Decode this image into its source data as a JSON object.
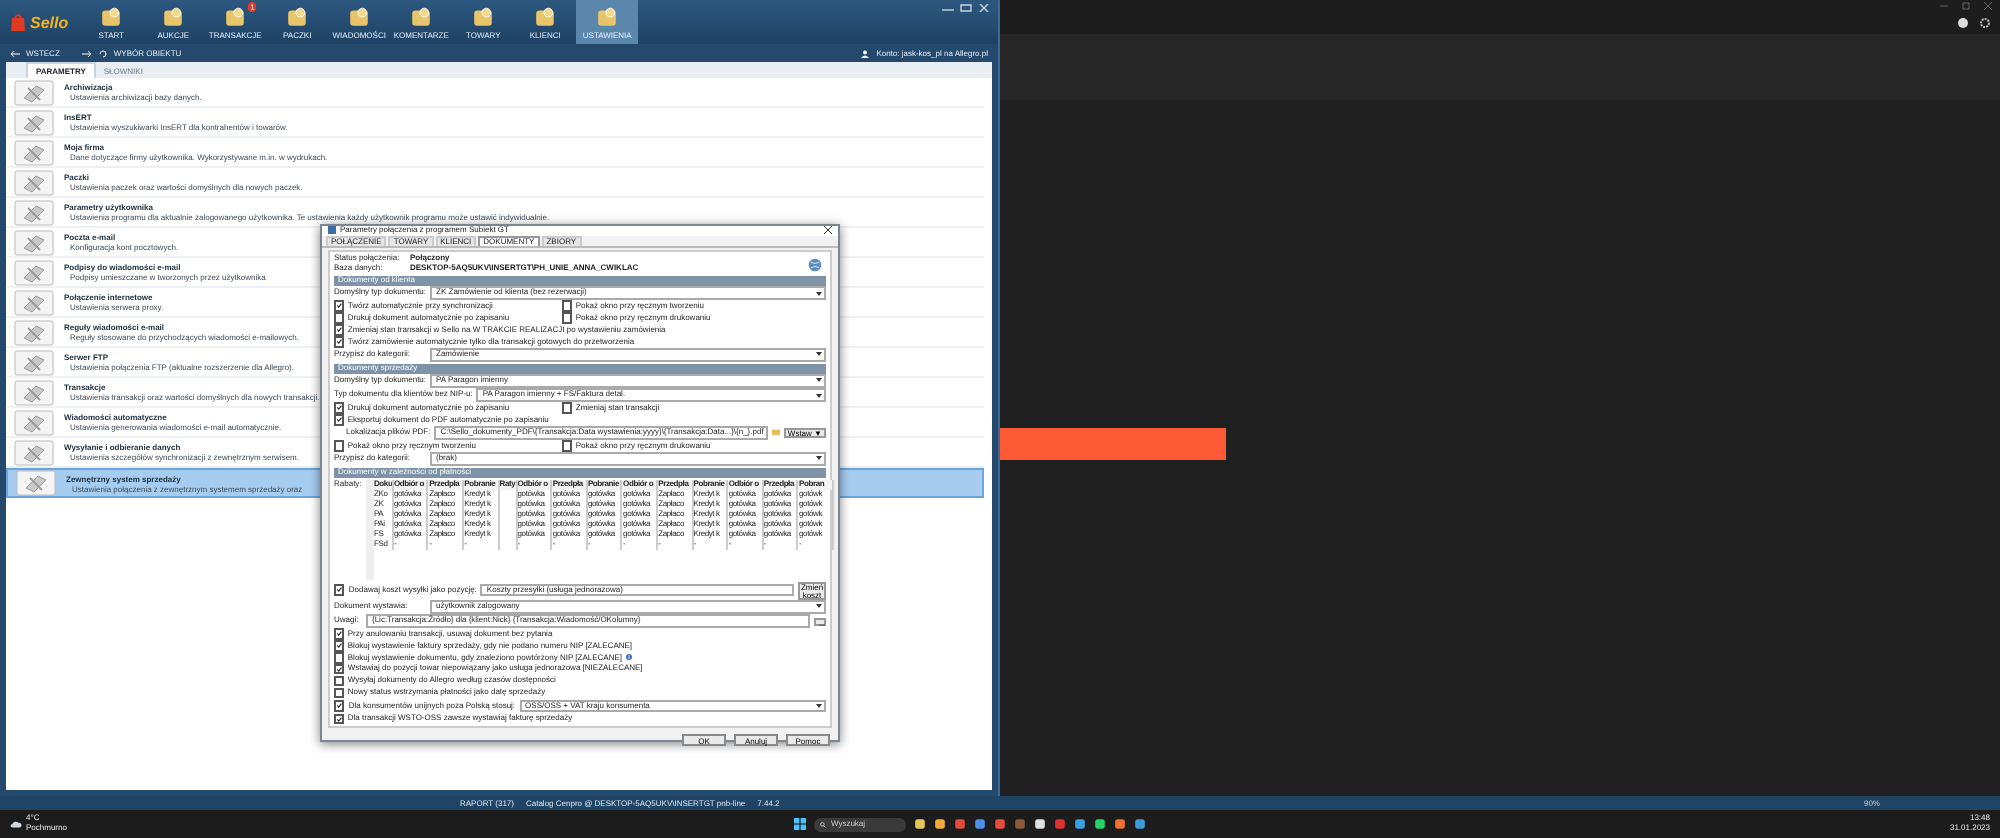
{
  "toolbar": {
    "logo": "Sello",
    "items": [
      {
        "label": "START",
        "selected": false
      },
      {
        "label": "AUKCJE",
        "selected": false
      },
      {
        "label": "TRANSAKCJE",
        "selected": false,
        "badge": "1"
      },
      {
        "label": "PACZKI",
        "selected": false
      },
      {
        "label": "WIADOMOŚCI",
        "selected": false
      },
      {
        "label": "KOMENTARZE",
        "selected": false
      },
      {
        "label": "TOWARY",
        "selected": false
      },
      {
        "label": "KLIENCI",
        "selected": false
      },
      {
        "label": "USTAWIENIA",
        "selected": true
      }
    ]
  },
  "nav": {
    "back": "WSTECZ",
    "object": "WYBÓR OBIEKTU",
    "account": "Konto: jask-kos_pl na Allegro.pl"
  },
  "tabs": [
    {
      "label": "PARAMETRY",
      "selected": true
    },
    {
      "label": "SŁOWNIKI",
      "selected": false
    }
  ],
  "settings": [
    {
      "title": "Archiwizacja",
      "description": "Ustawienia archiwizacji bazy danych.",
      "selected": false
    },
    {
      "title": "InsERT",
      "description": "Ustawienia wyszukiwarki InsERT dla kontrahentów i towarów.",
      "selected": false
    },
    {
      "title": "Moja firma",
      "description": "Dane dotyczące firmy użytkownika. Wykorzystywane m.in. w wydrukach.",
      "selected": false
    },
    {
      "title": "Paczki",
      "description": "Ustawienia paczek oraz wartości domyślnych dla nowych paczek.",
      "selected": false
    },
    {
      "title": "Parametry użytkownika",
      "description": "Ustawienia programu dla aktualnie zalogowanego użytkownika. Te ustawienia każdy użytkownik programu może ustawić indywidualnie.",
      "selected": false
    },
    {
      "title": "Poczta e-mail",
      "description": "Konfiguracja kont pocztowych.",
      "selected": false
    },
    {
      "title": "Podpisy do wiadomości e-mail",
      "description": "Podpisy umieszczane w tworzonych przez użytkownika",
      "selected": false
    },
    {
      "title": "Połączenie internetowe",
      "description": "Ustawienia serwera proxy.",
      "selected": false
    },
    {
      "title": "Reguły wiadomości e-mail",
      "description": "Reguły stosowane do przychodzących wiadomości e-mailowych.",
      "selected": false
    },
    {
      "title": "Serwer FTP",
      "description": "Ustawienia połączenia FTP (aktualne rozszerzenie dla Allegro).",
      "selected": false
    },
    {
      "title": "Transakcje",
      "description": "Ustawienia transakcji oraz wartości domyślnych dla nowych transakcji.",
      "selected": false
    },
    {
      "title": "Wiadomości automatyczne",
      "description": "Ustawienia generowania wiadomości e-mail automatycznie.",
      "selected": false
    },
    {
      "title": "Wysyłanie i odbieranie danych",
      "description": "Ustawienia szczegółów synchronizacji z zewnętrznym serwisem.",
      "selected": false
    },
    {
      "title": "Zewnętrzny system sprzedaży",
      "description": "Ustawienia połączenia z zewnętrznym systemem sprzedaży oraz",
      "selected": true
    }
  ],
  "dialog": {
    "title": "Parametry połączenia z programem Subiekt GT",
    "tabs": [
      {
        "label": "POŁĄCZENIE",
        "selected": false
      },
      {
        "label": "TOWARY",
        "selected": false
      },
      {
        "label": "KLIENCI",
        "selected": false
      },
      {
        "label": "DOKUMENTY",
        "selected": true
      },
      {
        "label": "ZBIORY",
        "selected": false
      }
    ],
    "fields": [
      {
        "label": "Status połączenia:",
        "value": "Połączony"
      },
      {
        "label": "Baza danych:",
        "value": "DESKTOP-5AQ5UKV\\INSERTGT\\PH_UNIE_ANNA_CWIKLAC"
      }
    ],
    "sections": [
      {
        "header": "Dokumenty od klienta",
        "rows": [
          {
            "kind": "select",
            "label": "Domyślny typ dokumentu:",
            "value": "ZK Zamówienie od klienta (bez rezerwacji)"
          },
          {
            "kind": "checks",
            "items": [
              {
                "label": "Twórz automatycznie przy synchronizacji",
                "checked": true
              },
              {
                "label": "Pokaż okno przy ręcznym tworzeniu",
                "checked": false
              }
            ]
          },
          {
            "kind": "checks",
            "items": [
              {
                "label": "Drukuj dokument automatycznie po zapisaniu",
                "checked": false
              },
              {
                "label": "Pokaż okno przy ręcznym drukowaniu",
                "checked": false
              }
            ]
          },
          {
            "kind": "checks",
            "items": [
              {
                "label": "Zmieniaj stan transakcji w Sello na W TRAKCIE REALIZACJI po wystawieniu zamówienia",
                "checked": true
              }
            ]
          },
          {
            "kind": "checks",
            "items": [
              {
                "label": "Twórz zamówienie automatycznie tylko dla transakcji gotowych do przetworzenia",
                "checked": true
              }
            ]
          },
          {
            "kind": "select",
            "label": "Przypisz do kategorii:",
            "value": "Zamówienie"
          }
        ]
      },
      {
        "header": "Dokumenty sprzedaży",
        "rows": [
          {
            "kind": "select",
            "label": "Domyślny typ dokumentu:",
            "value": "PA Paragon imienny"
          },
          {
            "kind": "select",
            "label": "Typ dokumentu dla klientów bez NIP-u:",
            "value": "PA Paragon imienny + FS/Faktura detal."
          },
          {
            "kind": "checks",
            "items": [
              {
                "label": "Drukuj dokument automatycznie po zapisaniu",
                "checked": true
              },
              {
                "label": "Zmieniaj stan transakcji",
                "checked": false
              }
            ]
          },
          {
            "kind": "checks",
            "items": [
              {
                "label": "Eksportuj dokument do PDF automatycznie po zapisaniu",
                "checked": true
              }
            ]
          },
          {
            "kind": "path",
            "label": "Lokalizacja plików PDF:",
            "value": "C:\\Sello_dokumenty_PDF\\{Transakcja:Data wystawienia:yyyy}\\{Transakcja:Data...}\\{n_}.pdf",
            "button": "Wstaw ▼"
          },
          {
            "kind": "checks",
            "items": [
              {
                "label": "Pokaż okno przy ręcznym tworzeniu",
                "checked": false
              },
              {
                "label": "Pokaż okno przy ręcznym drukowaniu",
                "checked": false
              }
            ]
          },
          {
            "kind": "select",
            "label": "Przypisz do kategorii:",
            "value": "(brak)"
          }
        ]
      },
      {
        "header": "Dokumenty w zależności od płatności",
        "table": {
          "label": "Rabaty:",
          "columns": [
            "Doku",
            "Odbiór o",
            "Przedpła",
            "Pobranie",
            "Raty",
            "Odbiór o",
            "Przedpła",
            "Pobranie",
            "Odbiór o",
            "Przedpła",
            "Pobranie",
            "Odbiór o",
            "Przedpła",
            "Pobran"
          ],
          "rows": [
            [
              "ZKo",
              "gotówka",
              "Zapłaco",
              "Kredyt k",
              "",
              "gotówka",
              "gotówka",
              "gotówka",
              "gotówka",
              "Zapłaco",
              "Kredyt k",
              "gotówka",
              "gotówka",
              "gotówk"
            ],
            [
              "ZK",
              "gotówka",
              "Zapłaco",
              "Kredyt k",
              "",
              "gotówka",
              "gotówka",
              "gotówka",
              "gotówka",
              "Zapłaco",
              "Kredyt k",
              "gotówka",
              "gotówka",
              "gotówk"
            ],
            [
              "PA",
              "gotówka",
              "Zapłaco",
              "Kredyt k",
              "",
              "gotówka",
              "gotówka",
              "gotówka",
              "gotówka",
              "Zapłaco",
              "Kredyt k",
              "gotówka",
              "gotówka",
              "gotówk"
            ],
            [
              "PAi",
              "gotówka",
              "Zapłaco",
              "Kredyt k",
              "",
              "gotówka",
              "gotówka",
              "gotówka",
              "gotówka",
              "Zapłaco",
              "Kredyt k",
              "gotówka",
              "gotówka",
              "gotówk"
            ],
            [
              "FS",
              "gotówka",
              "Zapłaco",
              "Kredyt k",
              "",
              "gotówka",
              "gotówka",
              "gotówka",
              "gotówka",
              "Zapłaco",
              "Kredyt k",
              "gotówka",
              "gotówka",
              "gotówk"
            ],
            [
              "FSd",
              "-",
              "-",
              "-",
              "",
              "-",
              "-",
              "-",
              "-",
              "-",
              "-",
              "-",
              "-",
              "-"
            ]
          ]
        }
      }
    ],
    "bottom": [
      {
        "kind": "check_field",
        "checked": true,
        "label": "Dodawaj koszt wysyłki jako pozycję:",
        "value": "Koszty przesyłki (usługa jednorazowa)",
        "button": "Zmień koszt"
      },
      {
        "kind": "select",
        "label": "Dokument wystawia:",
        "value": "użytkownik zalogowany"
      },
      {
        "kind": "text",
        "label": "Uwagi:",
        "value": "{Lic:Transakcja:Źródło} dla {klient:Nick} {Transakcja:Wiadomość/OKolumny}"
      },
      {
        "kind": "checks",
        "items": [
          {
            "label": "Przy anulowaniu transakcji, usuwaj dokument bez pytania",
            "checked": true
          }
        ]
      },
      {
        "kind": "checks",
        "items": [
          {
            "label": "Blokuj wystawienie faktury sprzedaży, gdy nie podano numeru NIP [ZALECANE]",
            "checked": true
          }
        ]
      },
      {
        "kind": "checks",
        "info": true,
        "items": [
          {
            "label": "Blokuj wystawienie dokumentu, gdy znaleziono powtórzony NIP [ZALECANE]",
            "checked": false
          }
        ]
      },
      {
        "kind": "checks",
        "items": [
          {
            "label": "Wstawiaj do pozycji towar niepowiązany jako usługa jednorazowa [NIEZALECANE]",
            "checked": true
          }
        ]
      },
      {
        "kind": "checks",
        "items": [
          {
            "label": "Wysyłaj dokumenty do Allegro według czasów dostępności",
            "checked": false
          }
        ]
      },
      {
        "kind": "checks",
        "items": [
          {
            "label": "Nowy status wstrzymania płatności jako datę sprzedaży",
            "checked": false
          }
        ]
      },
      {
        "kind": "check_select",
        "checked": true,
        "label": "Dla konsumentów unijnych poza Polską stosuj:",
        "value": "OSS/OSS + VAT kraju konsumenta"
      },
      {
        "kind": "checks",
        "items": [
          {
            "label": "Dla transakcji WSTO-OSS zawsze wystawiaj fakturę sprzedaży",
            "checked": true
          }
        ]
      }
    ],
    "buttons": [
      "OK",
      "Anuluj",
      "Pomoc"
    ]
  },
  "status_bar": {
    "items": [
      "RAPORT (317)",
      "Catalog Cenpro @ DESKTOP-5AQ5UKV\\INSERTGT pnb-line",
      "7.44.2"
    ],
    "zoom": "90%"
  },
  "taskbar": {
    "temperature": "4°C",
    "weather": "Pochmurno",
    "search": "Wyszukaj",
    "time": "13:48",
    "date": "31.01.2023"
  }
}
